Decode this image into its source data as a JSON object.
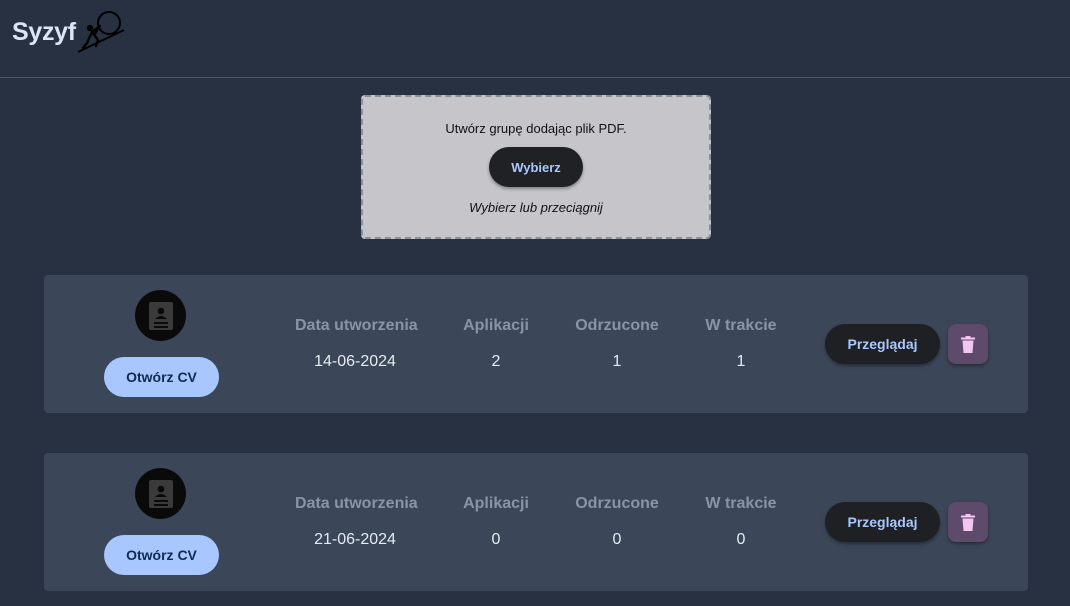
{
  "header": {
    "brand": "Syzyf"
  },
  "upload": {
    "instruction": "Utwórz grupę dodając plik PDF.",
    "button_label": "Wybierz",
    "hint": "Wybierz lub przeciągnij"
  },
  "columns": {
    "created": "Data utworzenia",
    "applications": "Aplikacji",
    "rejected": "Odrzucone",
    "in_progress": "W trakcie"
  },
  "groups": [
    {
      "open_cv_label": "Otwórz CV",
      "created": "14-06-2024",
      "applications": "2",
      "rejected": "1",
      "in_progress": "1",
      "browse_label": "Przeglądaj",
      "delete_icon": "trash-icon"
    },
    {
      "open_cv_label": "Otwórz CV",
      "created": "21-06-2024",
      "applications": "0",
      "rejected": "0",
      "in_progress": "0",
      "browse_label": "Przeglądaj",
      "delete_icon": "trash-icon"
    }
  ],
  "colors": {
    "background": "#283142",
    "card": "#3b4658",
    "accent": "#a9c7ff",
    "delete": "#5e4a6a"
  }
}
